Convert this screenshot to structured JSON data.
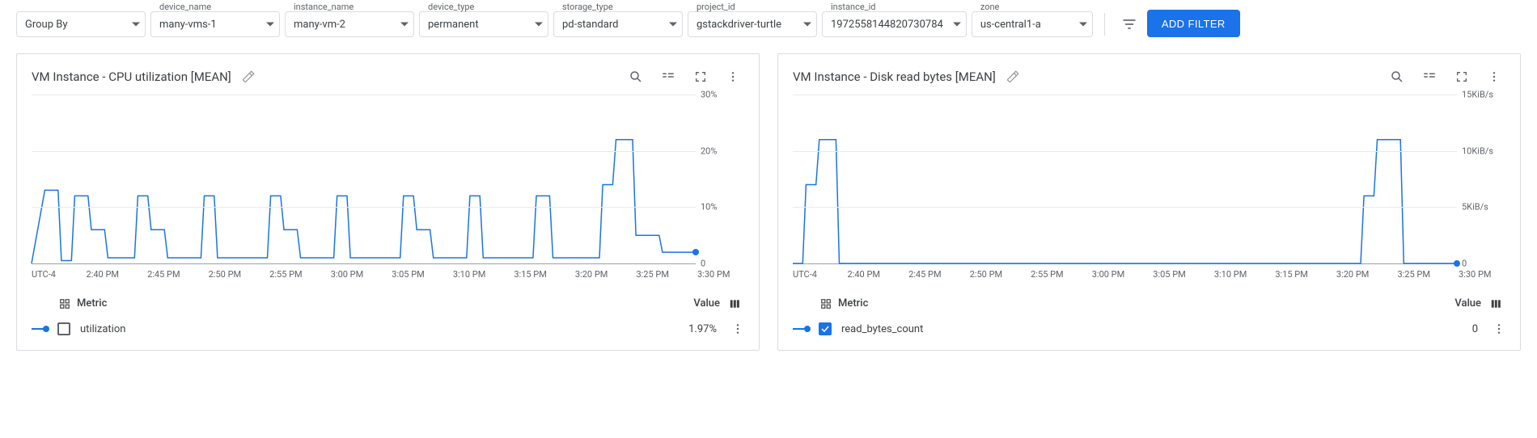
{
  "filters": {
    "group_by": {
      "label": "Group By",
      "value": ""
    },
    "device_name": {
      "label": "device_name",
      "value": "many-vms-1"
    },
    "instance_name": {
      "label": "instance_name",
      "value": "many-vm-2"
    },
    "device_type": {
      "label": "device_type",
      "value": "permanent"
    },
    "storage_type": {
      "label": "storage_type",
      "value": "pd-standard"
    },
    "project_id": {
      "label": "project_id",
      "value": "gstackdriver-turtle"
    },
    "instance_id": {
      "label": "instance_id",
      "value": "1972558144820730784"
    },
    "zone": {
      "label": "zone",
      "value": "us-central1-a"
    },
    "add_filter_label": "ADD FILTER"
  },
  "panels": [
    {
      "title": "VM Instance - CPU utilization [MEAN]",
      "legend_header_metric": "Metric",
      "legend_header_value": "Value",
      "series": {
        "name": "utilization",
        "checked": false,
        "value_display": "1.97%"
      }
    },
    {
      "title": "VM Instance - Disk read bytes [MEAN]",
      "legend_header_metric": "Metric",
      "legend_header_value": "Value",
      "series": {
        "name": "read_bytes_count",
        "checked": true,
        "value_display": "0"
      }
    }
  ],
  "chart_data": [
    {
      "type": "line",
      "title": "VM Instance - CPU utilization [MEAN]",
      "ylabel": "",
      "xlabel": "UTC-4",
      "ylim": [
        0,
        30
      ],
      "yunit": "%",
      "yticks": [
        0,
        10,
        20,
        30
      ],
      "ytick_labels": [
        "0",
        "10%",
        "20%",
        "30%"
      ],
      "xtick_labels": [
        "UTC-4",
        "2:40 PM",
        "2:45 PM",
        "2:50 PM",
        "2:55 PM",
        "3:00 PM",
        "3:05 PM",
        "3:10 PM",
        "3:15 PM",
        "3:20 PM",
        "3:25 PM",
        "3:30 PM"
      ],
      "series": [
        {
          "name": "utilization",
          "color": "#1a73e8",
          "points": [
            [
              0.0,
              0
            ],
            [
              0.02,
              13
            ],
            [
              0.04,
              13
            ],
            [
              0.045,
              0.5
            ],
            [
              0.06,
              0.5
            ],
            [
              0.065,
              12
            ],
            [
              0.085,
              12
            ],
            [
              0.09,
              6
            ],
            [
              0.11,
              6
            ],
            [
              0.115,
              1
            ],
            [
              0.155,
              1
            ],
            [
              0.16,
              12
            ],
            [
              0.175,
              12
            ],
            [
              0.18,
              6
            ],
            [
              0.2,
              6
            ],
            [
              0.205,
              1
            ],
            [
              0.255,
              1
            ],
            [
              0.26,
              12
            ],
            [
              0.275,
              12
            ],
            [
              0.28,
              1
            ],
            [
              0.355,
              1
            ],
            [
              0.36,
              12
            ],
            [
              0.375,
              12
            ],
            [
              0.38,
              6
            ],
            [
              0.4,
              6
            ],
            [
              0.405,
              1
            ],
            [
              0.455,
              1
            ],
            [
              0.46,
              12
            ],
            [
              0.475,
              12
            ],
            [
              0.48,
              1
            ],
            [
              0.555,
              1
            ],
            [
              0.56,
              12
            ],
            [
              0.575,
              12
            ],
            [
              0.58,
              6
            ],
            [
              0.6,
              6
            ],
            [
              0.605,
              1
            ],
            [
              0.655,
              1
            ],
            [
              0.66,
              12
            ],
            [
              0.675,
              12
            ],
            [
              0.68,
              1
            ],
            [
              0.755,
              1
            ],
            [
              0.76,
              12
            ],
            [
              0.78,
              12
            ],
            [
              0.785,
              1
            ],
            [
              0.855,
              1
            ],
            [
              0.86,
              14
            ],
            [
              0.875,
              14
            ],
            [
              0.88,
              22
            ],
            [
              0.905,
              22
            ],
            [
              0.91,
              5
            ],
            [
              0.945,
              5
            ],
            [
              0.95,
              2
            ],
            [
              1.0,
              2
            ]
          ],
          "last_value": 1.97
        }
      ]
    },
    {
      "type": "line",
      "title": "VM Instance - Disk read bytes [MEAN]",
      "ylabel": "",
      "xlabel": "UTC-4",
      "ylim": [
        0,
        15
      ],
      "yunit": "KiB/s",
      "yticks": [
        0,
        5,
        10,
        15
      ],
      "ytick_labels": [
        "0",
        "5KiB/s",
        "10KiB/s",
        "15KiB/s"
      ],
      "xtick_labels": [
        "UTC-4",
        "2:40 PM",
        "2:45 PM",
        "2:50 PM",
        "2:55 PM",
        "3:00 PM",
        "3:05 PM",
        "3:10 PM",
        "3:15 PM",
        "3:20 PM",
        "3:25 PM",
        "3:30 PM"
      ],
      "series": [
        {
          "name": "read_bytes_count",
          "color": "#1a73e8",
          "points": [
            [
              0.0,
              0
            ],
            [
              0.015,
              0
            ],
            [
              0.02,
              7
            ],
            [
              0.035,
              7
            ],
            [
              0.04,
              11
            ],
            [
              0.065,
              11
            ],
            [
              0.07,
              0
            ],
            [
              0.855,
              0
            ],
            [
              0.86,
              6
            ],
            [
              0.875,
              6
            ],
            [
              0.88,
              11
            ],
            [
              0.915,
              11
            ],
            [
              0.92,
              0
            ],
            [
              1.0,
              0
            ]
          ],
          "last_value": 0
        }
      ]
    }
  ]
}
